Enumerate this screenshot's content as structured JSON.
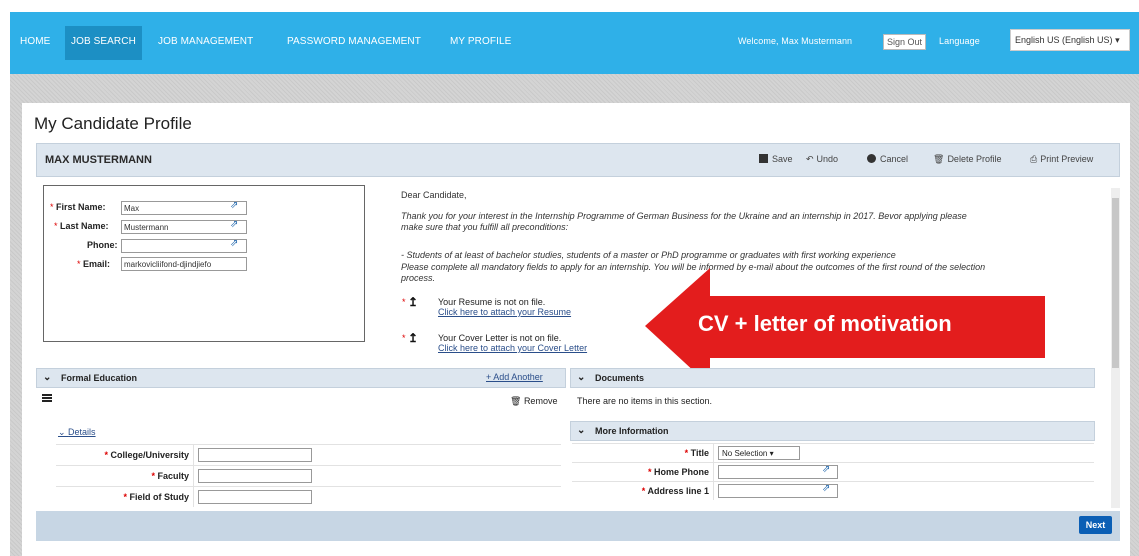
{
  "nav": {
    "items": [
      {
        "label": "HOME"
      },
      {
        "label": "JOB SEARCH"
      },
      {
        "label": "JOB MANAGEMENT"
      },
      {
        "label": "PASSWORD MANAGEMENT"
      },
      {
        "label": "MY PROFILE"
      }
    ],
    "active_index": 1,
    "welcome": "Welcome, Max Mustermann",
    "sign_out": "Sign Out",
    "language_label": "Language",
    "language_value": "English US (English US)"
  },
  "page": {
    "title": "My Candidate Profile"
  },
  "profile": {
    "name": "MAX MUSTERMANN",
    "actions": {
      "save": "Save",
      "undo": "Undo",
      "cancel": "Cancel",
      "delete": "Delete Profile",
      "print": "Print Preview"
    }
  },
  "personal": {
    "first_name_label": "First Name:",
    "first_name_value": "Max",
    "last_name_label": "Last Name:",
    "last_name_value": "Mustermann",
    "phone_label": "Phone:",
    "phone_value": "",
    "email_label": "Email:",
    "email_value": "markovicliifond-djindjiefo"
  },
  "intro": {
    "greeting": "Dear Candidate,",
    "p1_line1": "Thank you for your interest in the Internship Programme of German Business for the Ukraine and an internship in 2017. Bevor applying please",
    "p1_line2": "make sure that you fulfill all preconditions:",
    "p2_line1": "- Students of at least of bachelor studies, students of a master or PhD programme or graduates with first working experience",
    "p2_line2": "Please complete all mandatory fields to apply for an internship. You will be informed by e-mail about the outcomes of the first round of the selection",
    "p2_line3": "process."
  },
  "uploads": {
    "resume_status": "Your Resume is not on file.",
    "resume_link": "Click here to attach your Resume",
    "cover_status": "Your Cover Letter is not on file.",
    "cover_link": "Click here to attach your Cover Letter"
  },
  "annotation": {
    "text": "CV + letter of motivation",
    "color": "#e31d1d"
  },
  "education": {
    "title": "Formal Education",
    "add_another": "+ Add Another",
    "remove": "Remove",
    "details": "Details",
    "fields": [
      {
        "label": "College/University"
      },
      {
        "label": "Faculty"
      },
      {
        "label": "Field of Study"
      }
    ]
  },
  "documents": {
    "title": "Documents",
    "empty": "There are no items in this section."
  },
  "more_info": {
    "title": "More Information",
    "title_label": "Title",
    "title_value": "No Selection",
    "home_phone_label": "Home Phone",
    "address_label": "Address line 1"
  },
  "footer": {
    "next": "Next"
  },
  "colors": {
    "nav_bg": "#2fb0e8",
    "nav_active": "#1c8fc4",
    "section_bg": "#dde6ef",
    "next_btn": "#0b5fb5",
    "required": "#dd0000"
  }
}
